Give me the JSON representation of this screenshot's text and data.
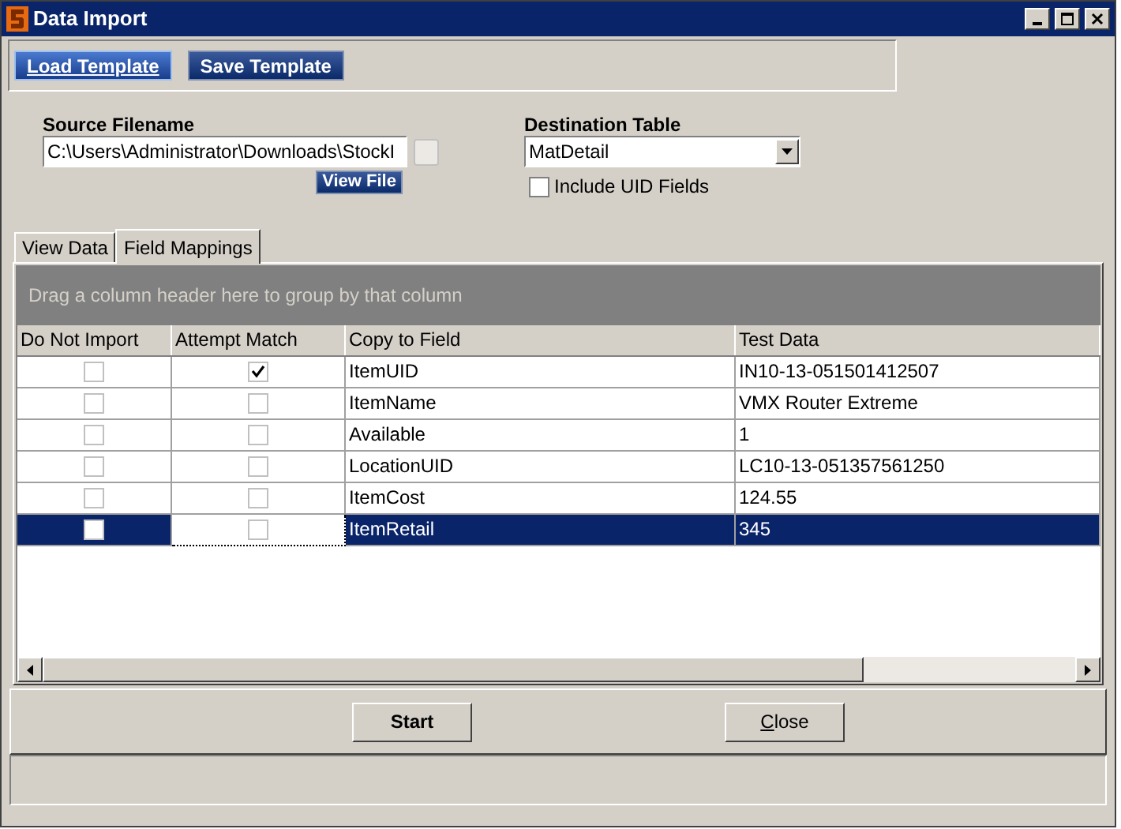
{
  "window": {
    "title": "Data Import"
  },
  "toolbar": [
    {
      "label": "Load Template",
      "selected": true
    },
    {
      "label": "Save Template",
      "selected": false
    }
  ],
  "source": {
    "label": "Source Filename",
    "value": "C:\\Users\\Administrator\\Downloads\\StockI",
    "view_button": "View File"
  },
  "destination": {
    "label": "Destination Table",
    "value": "MatDetail",
    "include_uid": {
      "label": "Include UID Fields",
      "checked": false
    }
  },
  "tabs": [
    {
      "label": "View Data",
      "selected": false
    },
    {
      "label": "Field Mappings",
      "selected": true
    }
  ],
  "grid": {
    "group_hint": "Drag a column header here to group by that column",
    "columns": [
      "Do Not Import",
      "Attempt Match",
      "Copy to Field",
      "Test Data"
    ],
    "rows": [
      {
        "do_not_import": false,
        "attempt_match": true,
        "field": "ItemUID",
        "test": "IN10-13-051501412507",
        "selected": false
      },
      {
        "do_not_import": false,
        "attempt_match": false,
        "field": "ItemName",
        "test": "VMX Router Extreme",
        "selected": false
      },
      {
        "do_not_import": false,
        "attempt_match": false,
        "field": "Available",
        "test": "1",
        "selected": false
      },
      {
        "do_not_import": false,
        "attempt_match": false,
        "field": "LocationUID",
        "test": "LC10-13-051357561250",
        "selected": false
      },
      {
        "do_not_import": false,
        "attempt_match": false,
        "field": "ItemCost",
        "test": "124.55",
        "selected": false
      },
      {
        "do_not_import": false,
        "attempt_match": false,
        "field": "ItemRetail",
        "test": "345",
        "selected": true
      }
    ]
  },
  "buttons": [
    {
      "label": "Start",
      "bold": true,
      "underline_first": false
    },
    {
      "label": "Close",
      "bold": false,
      "underline_first": true
    }
  ]
}
